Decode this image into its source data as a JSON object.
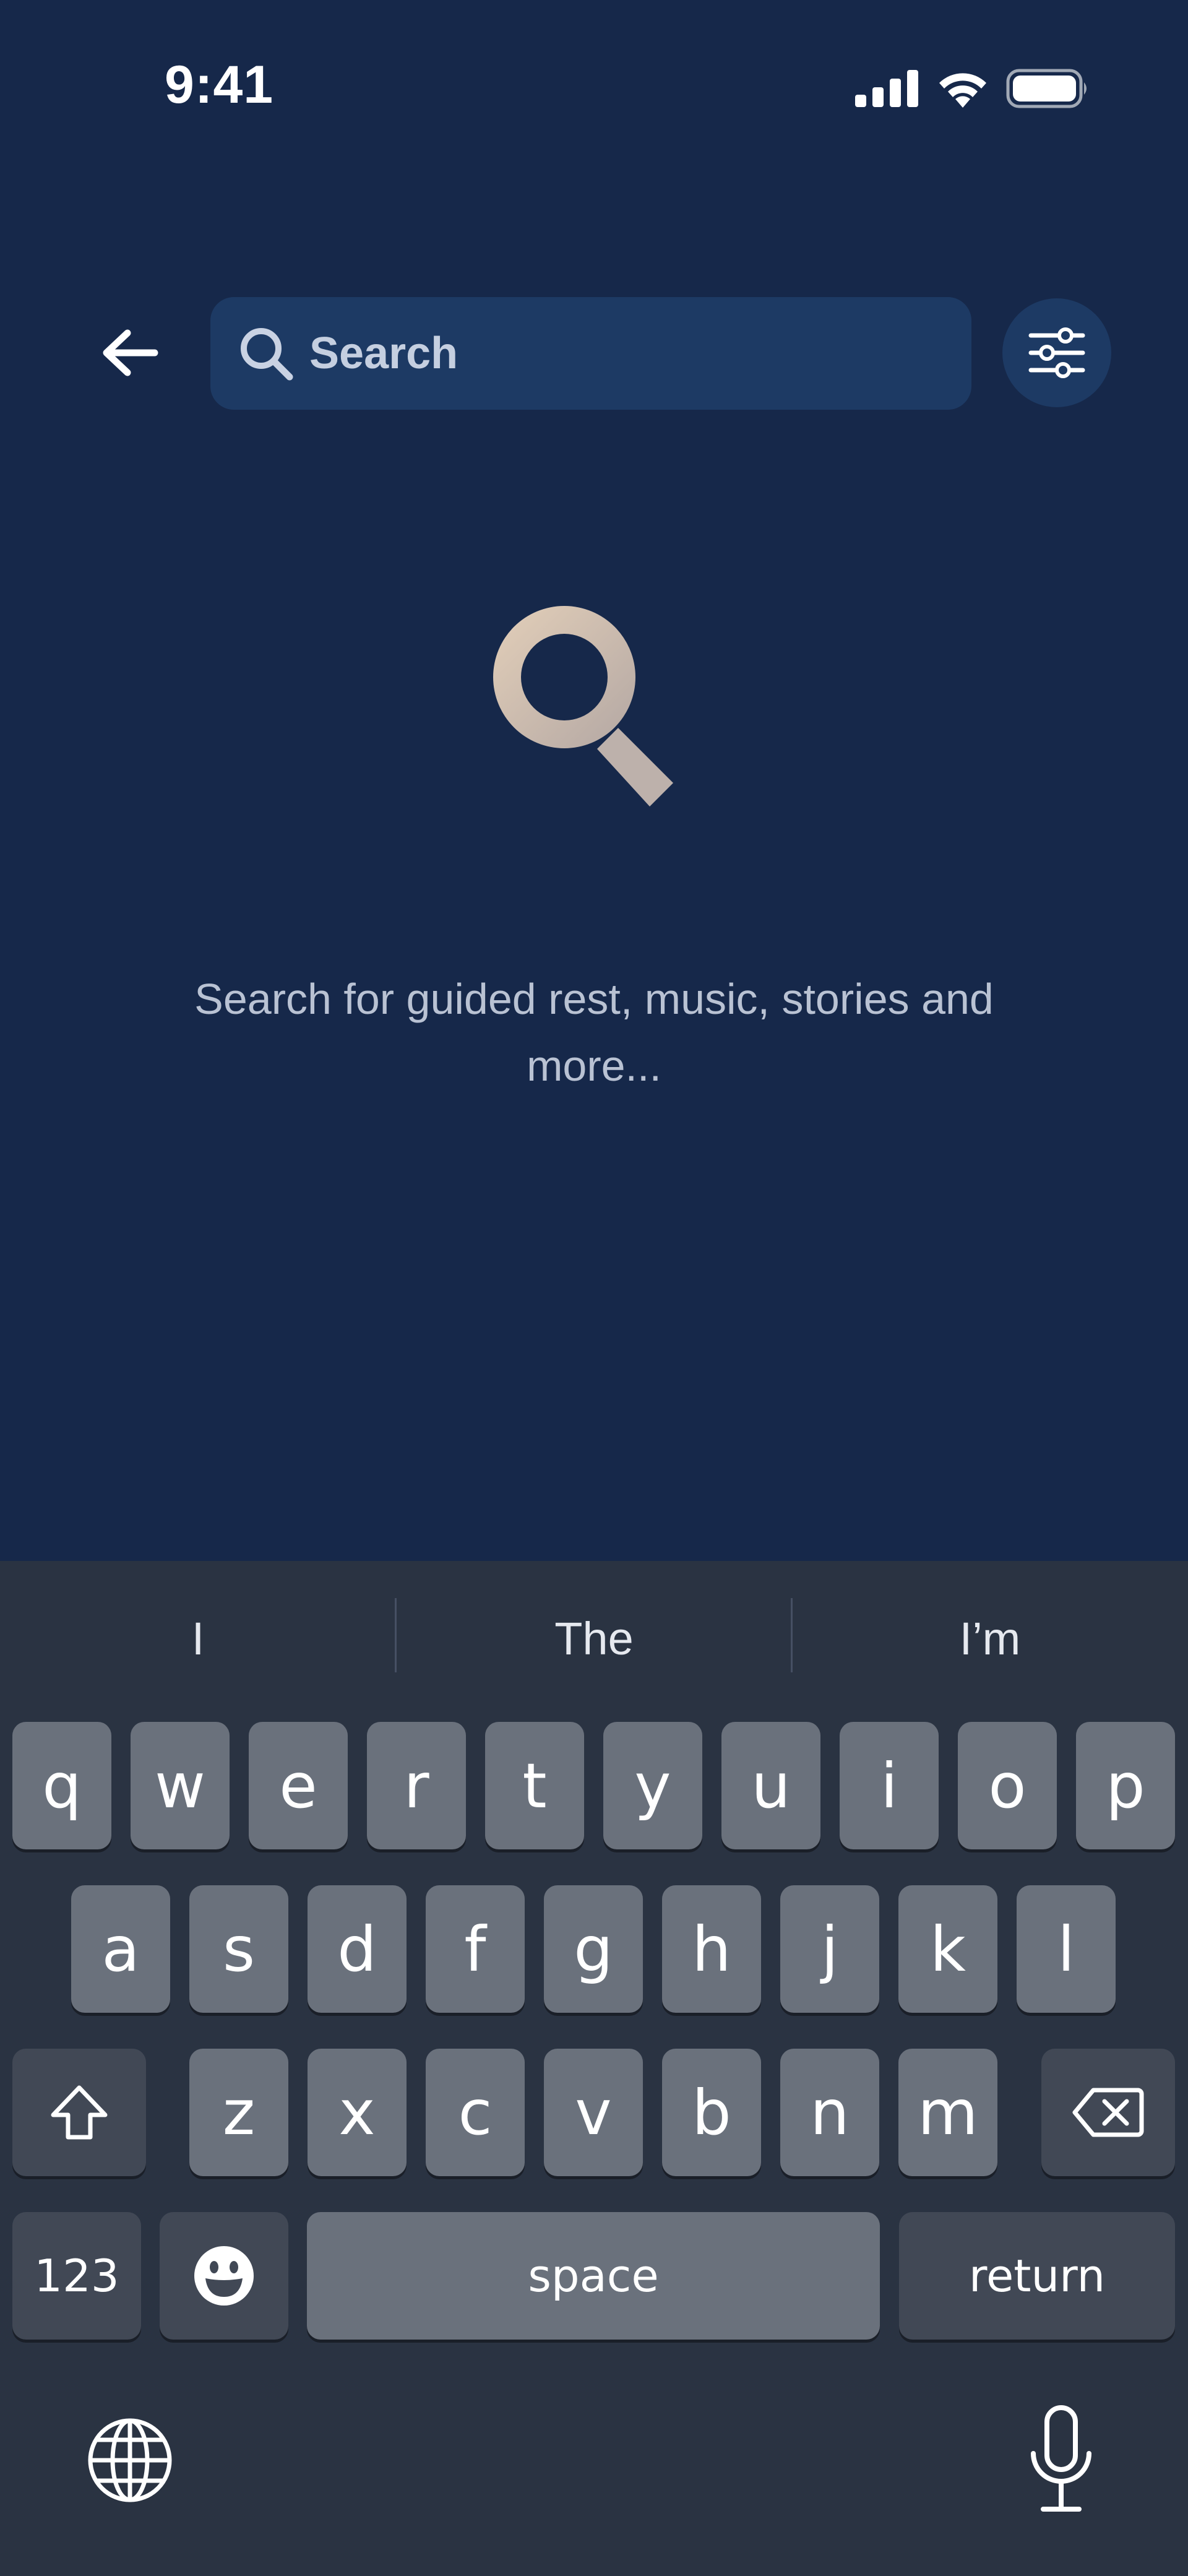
{
  "status_bar": {
    "time": "9:41",
    "icons": [
      "cellular-signal-icon",
      "wifi-icon",
      "battery-icon"
    ]
  },
  "search": {
    "placeholder": "Search",
    "value": "",
    "back_icon": "arrow-left-icon",
    "search_icon": "magnifier-icon",
    "filter_icon": "sliders-icon"
  },
  "empty_state": {
    "illustration": "magnifier-illustration",
    "message": "Search for guided rest, music, stories and more..."
  },
  "keyboard": {
    "suggestions": [
      "I",
      "The",
      "I’m"
    ],
    "row1": [
      "q",
      "w",
      "e",
      "r",
      "t",
      "y",
      "u",
      "i",
      "o",
      "p"
    ],
    "row2": [
      "a",
      "s",
      "d",
      "f",
      "g",
      "h",
      "j",
      "k",
      "l"
    ],
    "row3": [
      "z",
      "x",
      "c",
      "v",
      "b",
      "n",
      "m"
    ],
    "numbers_label": "123",
    "space_label": "space",
    "return_label": "return",
    "special_icons": [
      "shift-icon",
      "backspace-icon",
      "emoji-icon",
      "globe-icon",
      "microphone-icon"
    ]
  },
  "colors": {
    "background": "#16284a",
    "search_field": "#1d3a64",
    "illustration": "#d9c4ad",
    "keyboard_bg": "#2a3342",
    "key": "#6a717c",
    "key_dark": "#414855"
  }
}
